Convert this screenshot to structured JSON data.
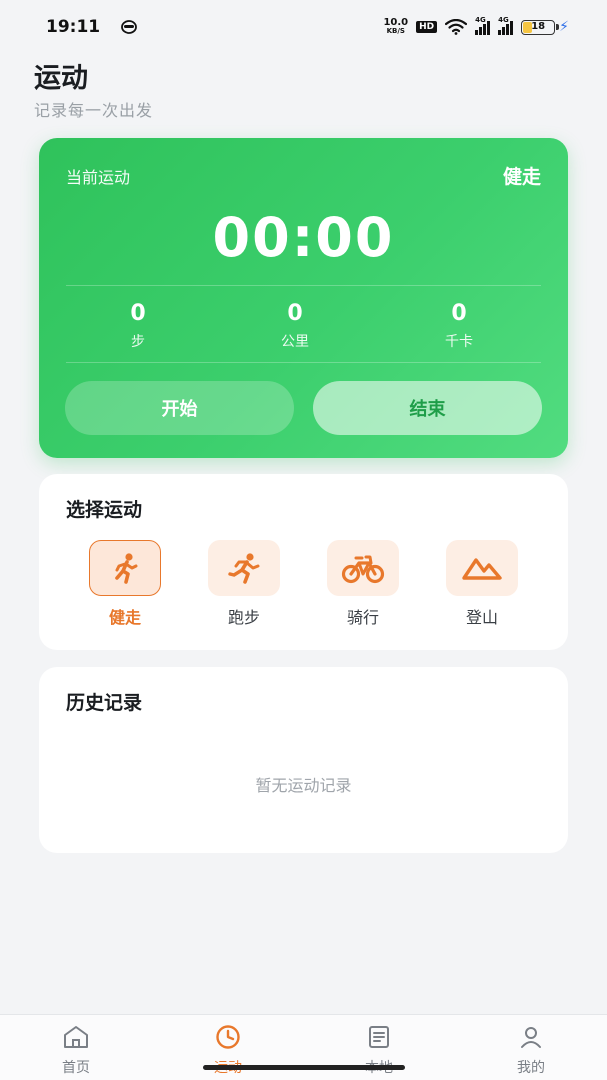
{
  "status_bar": {
    "time": "19:11",
    "net_speed": "10.0",
    "net_unit": "KB/S",
    "hd": "HD",
    "net1": "4G",
    "net2": "4G",
    "battery": "18"
  },
  "header": {
    "title": "运动",
    "subtitle": "记录每一次出发"
  },
  "hero": {
    "label": "当前运动",
    "current_type": "健走",
    "timer": "00:00",
    "stats": [
      {
        "value": "0",
        "unit": "步"
      },
      {
        "value": "0",
        "unit": "公里"
      },
      {
        "value": "0",
        "unit": "千卡"
      }
    ],
    "start_label": "开始",
    "end_label": "结束"
  },
  "select": {
    "title": "选择运动",
    "sports": [
      {
        "label": "健走",
        "icon": "walk-icon",
        "active": true
      },
      {
        "label": "跑步",
        "icon": "run-icon",
        "active": false
      },
      {
        "label": "骑行",
        "icon": "bike-icon",
        "active": false
      },
      {
        "label": "登山",
        "icon": "mountain-icon",
        "active": false
      }
    ]
  },
  "history": {
    "title": "历史记录",
    "empty_text": "暂无运动记录"
  },
  "tabs": [
    {
      "label": "首页",
      "icon": "home-icon"
    },
    {
      "label": "运动",
      "icon": "clock-icon",
      "active": true
    },
    {
      "label": "本地",
      "icon": "document-icon"
    },
    {
      "label": "我的",
      "icon": "user-icon"
    }
  ],
  "colors": {
    "accent": "#e8782c",
    "hero_green": "#3ccf6d",
    "end_text": "#1f9e49"
  }
}
